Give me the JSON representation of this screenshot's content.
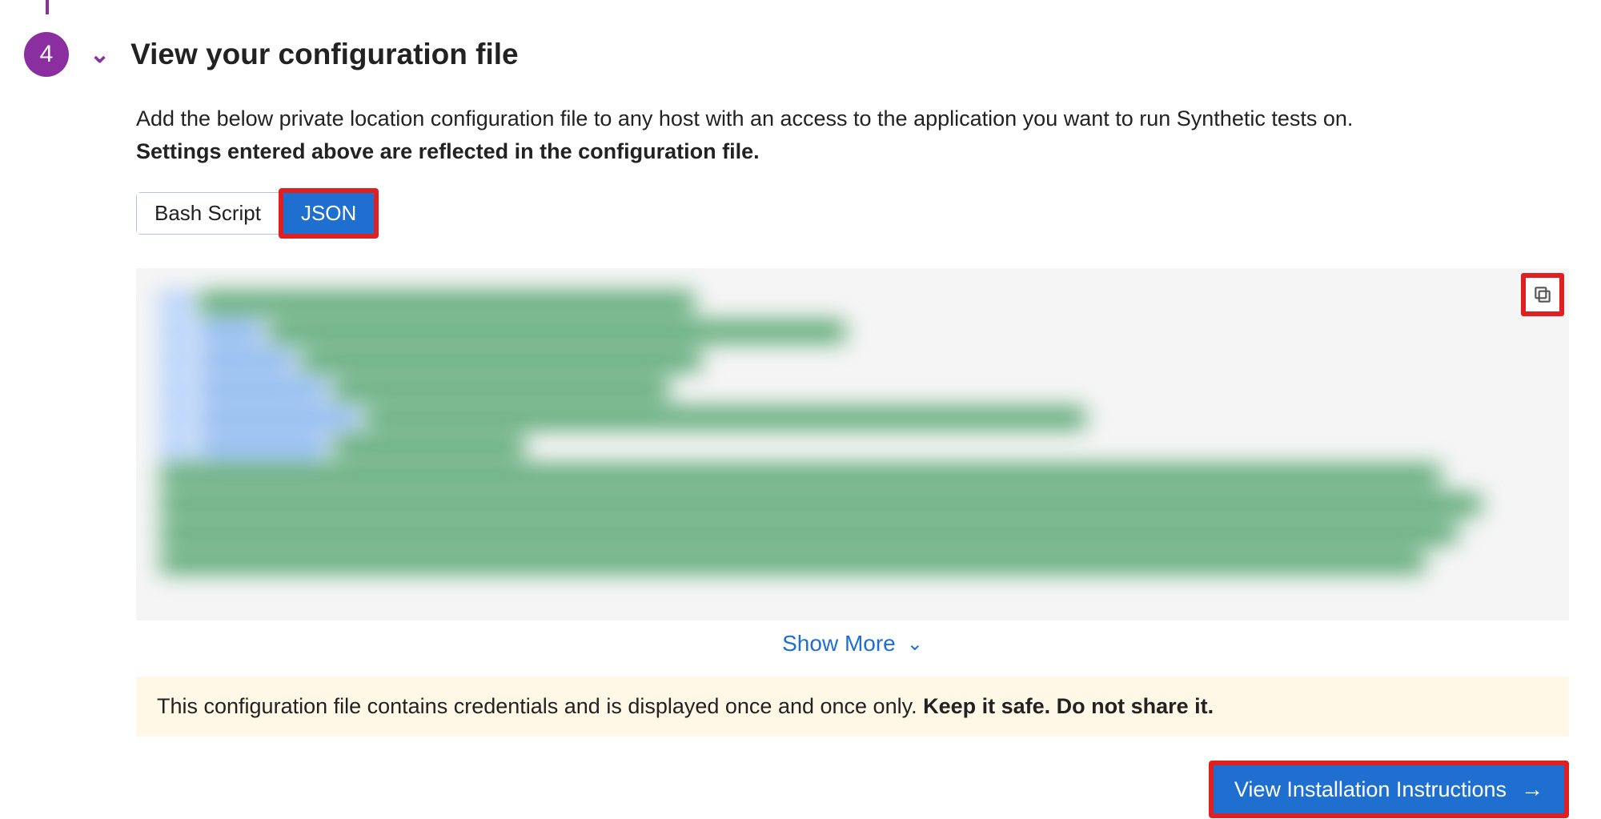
{
  "step": {
    "number": "4",
    "title": "View your configuration file"
  },
  "description": {
    "line1": "Add the below private location configuration file to any host with an access to the application you want to run Synthetic tests on.",
    "line2_bold": "Settings entered above are reflected in the configuration file."
  },
  "toggle": {
    "bash_label": "Bash Script",
    "json_label": "JSON"
  },
  "icons": {
    "copy": "copy-icon",
    "chevron_down": "chevron-down-icon",
    "arrow_right": "arrow-right-icon"
  },
  "show_more_label": "Show More",
  "warning": {
    "text": "This configuration file contains credentials and is displayed once and once only. ",
    "bold": "Keep it safe. Do not share it."
  },
  "cta_label": "View Installation Instructions"
}
